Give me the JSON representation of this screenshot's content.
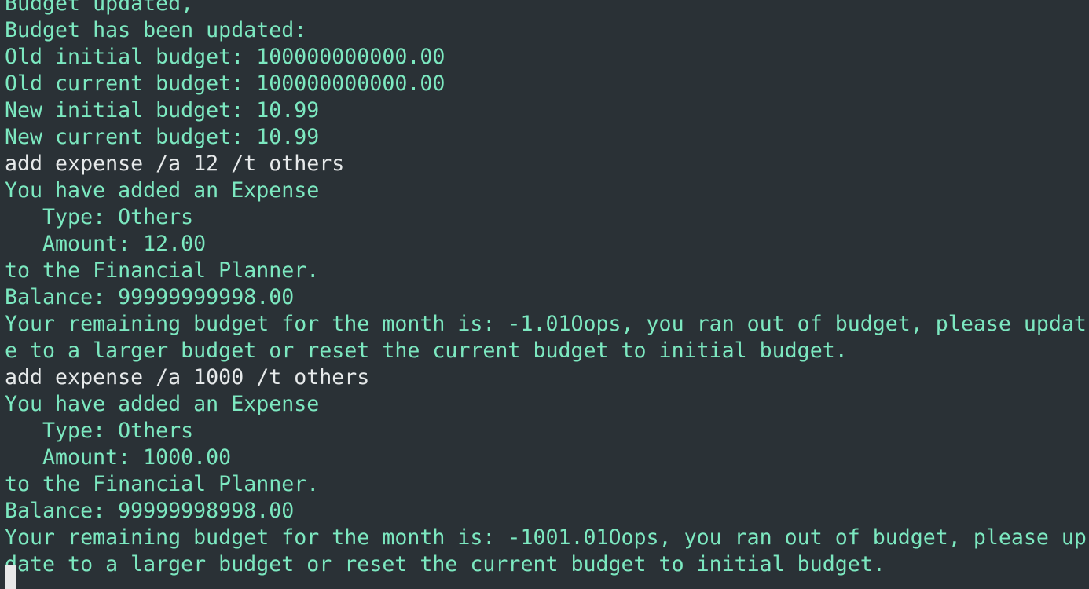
{
  "terminal": {
    "lines": [
      {
        "kind": "output",
        "text": "Budget updated,"
      },
      {
        "kind": "output",
        "text": "Budget has been updated:"
      },
      {
        "kind": "output",
        "text": "Old initial budget: 100000000000.00"
      },
      {
        "kind": "output",
        "text": "Old current budget: 100000000000.00"
      },
      {
        "kind": "output",
        "text": "New initial budget: 10.99"
      },
      {
        "kind": "output",
        "text": "New current budget: 10.99"
      },
      {
        "kind": "command",
        "text": "add expense /a 12 /t others"
      },
      {
        "kind": "output",
        "text": "You have added an Expense"
      },
      {
        "kind": "output",
        "text": "   Type: Others"
      },
      {
        "kind": "output",
        "text": "   Amount: 12.00"
      },
      {
        "kind": "output",
        "text": "to the Financial Planner."
      },
      {
        "kind": "output",
        "text": "Balance: 99999999998.00"
      },
      {
        "kind": "output",
        "text": "Your remaining budget for the month is: -1.01Oops, you ran out of budget, please updat"
      },
      {
        "kind": "output",
        "text": "e to a larger budget or reset the current budget to initial budget."
      },
      {
        "kind": "command",
        "text": "add expense /a 1000 /t others"
      },
      {
        "kind": "output",
        "text": "You have added an Expense"
      },
      {
        "kind": "output",
        "text": "   Type: Others"
      },
      {
        "kind": "output",
        "text": "   Amount: 1000.00"
      },
      {
        "kind": "output",
        "text": "to the Financial Planner."
      },
      {
        "kind": "output",
        "text": "Balance: 99999998998.00"
      },
      {
        "kind": "output",
        "text": "Your remaining budget for the month is: -1001.01Oops, you ran out of budget, please up"
      },
      {
        "kind": "output",
        "text": "date to a larger budget or reset the current budget to initial budget."
      }
    ]
  },
  "colors": {
    "background": "#2a3136",
    "output_text": "#7ce8c0",
    "command_text": "#e6e9ea",
    "cursor": "#e8e8e8"
  }
}
